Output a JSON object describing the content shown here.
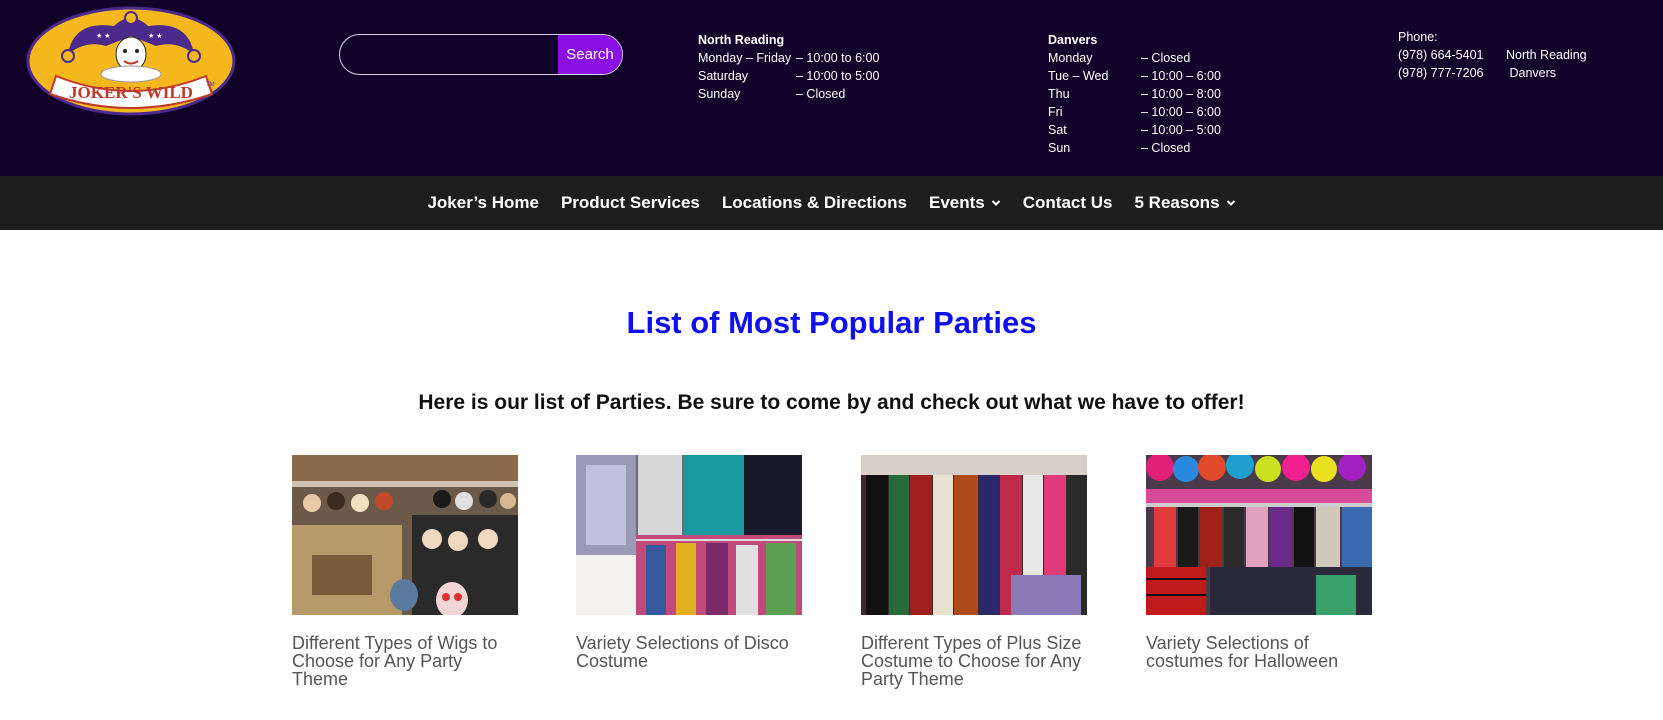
{
  "brand": {
    "logo_text": "JOKER'S WILD",
    "trademark": "TM"
  },
  "search": {
    "placeholder": "",
    "button_label": "Search"
  },
  "hours": {
    "north_reading": {
      "title": "North Reading",
      "rows": [
        {
          "day": "Monday – Friday",
          "time": "– 10:00 to 6:00"
        },
        {
          "day": "Saturday",
          "time": "– 10:00 to 5:00"
        },
        {
          "day": "Sunday",
          "time": "– Closed"
        }
      ]
    },
    "danvers": {
      "title": "Danvers",
      "rows": [
        {
          "day": "Monday",
          "time": "– Closed"
        },
        {
          "day": "Tue – Wed",
          "time": "– 10:00 – 6:00"
        },
        {
          "day": "Thu",
          "time": "– 10:00 – 8:00"
        },
        {
          "day": "Fri",
          "time": "– 10:00 – 6:00"
        },
        {
          "day": "Sat",
          "time": "– 10:00 – 5:00"
        },
        {
          "day": "Sun",
          "time": "– Closed"
        }
      ]
    }
  },
  "phones": {
    "label": "Phone:",
    "rows": [
      {
        "number": "(978) 664-5401",
        "location": "North Reading"
      },
      {
        "number": "(978) 777-7206",
        "location": " Danvers"
      }
    ]
  },
  "nav": {
    "items": [
      {
        "label": "Joker’s Home"
      },
      {
        "label": "Product Services"
      },
      {
        "label": "Locations & Directions"
      },
      {
        "label": "Events"
      },
      {
        "label": "Contact Us"
      },
      {
        "label": "5 Reasons"
      }
    ]
  },
  "main": {
    "title": "List of Most Popular Parties",
    "subtitle": "Here is our list of Parties. Be sure to come by and check out what we have to offer!",
    "cards": [
      {
        "caption": "Different Types of Wigs to Choose for Any Party Theme"
      },
      {
        "caption": "Variety Selections of Disco Costume"
      },
      {
        "caption": "Different Types of Plus Size Costume to Choose for Any Party Theme"
      },
      {
        "caption": "Variety Selections of costumes for Halloween"
      }
    ]
  },
  "colors": {
    "header_bg": "#12022a",
    "nav_bg": "#1e1e1e",
    "search_button": "#8a10e6",
    "title_blue": "#1010ee",
    "logo_yellow": "#f5b81c",
    "logo_purple": "#4b2a8c"
  }
}
